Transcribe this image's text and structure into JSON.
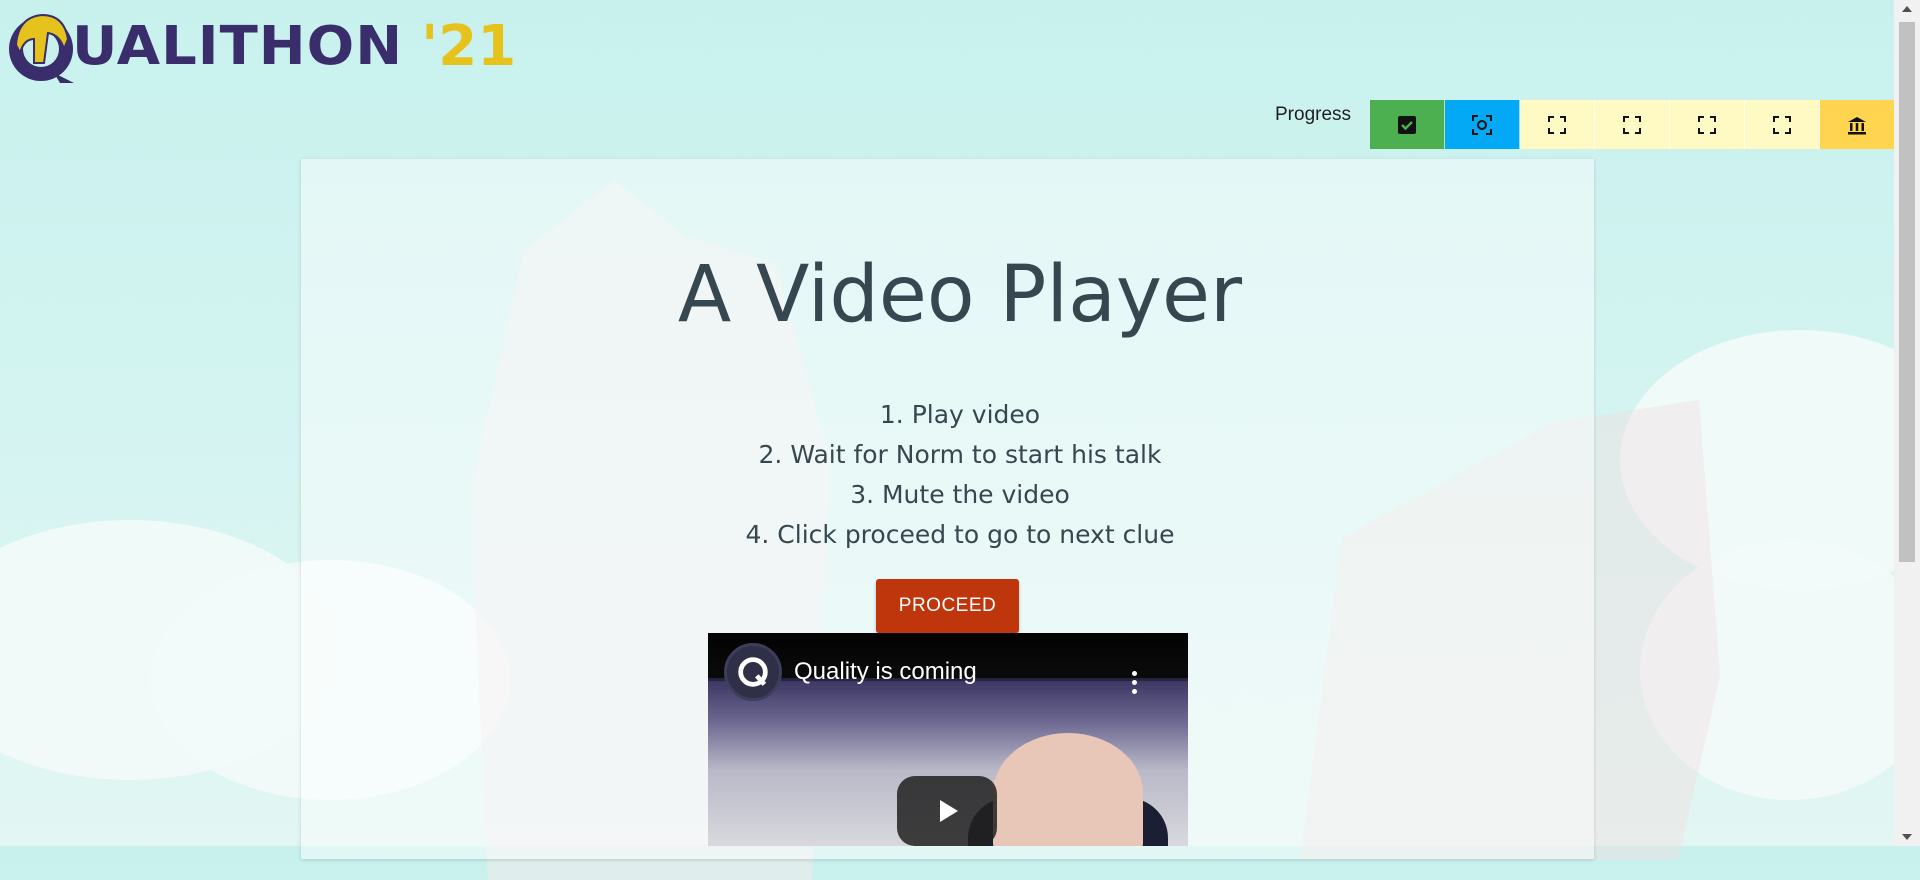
{
  "logo": {
    "main_text": "UALITHON",
    "year_text": "'21",
    "icon": "spartan-helmet-icon"
  },
  "progress": {
    "label": "Progress",
    "steps": [
      {
        "name": "completed",
        "icon": "check-box-icon",
        "color": "#4caf50"
      },
      {
        "name": "current",
        "icon": "focus-target-icon",
        "color": "#03a9f4"
      },
      {
        "name": "locked-1",
        "icon": "fullscreen-corners-icon",
        "color": "#fff9c4"
      },
      {
        "name": "locked-2",
        "icon": "fullscreen-corners-icon",
        "color": "#fff9c4"
      },
      {
        "name": "locked-3",
        "icon": "fullscreen-corners-icon",
        "color": "#fff9c4"
      },
      {
        "name": "locked-4",
        "icon": "fullscreen-corners-icon",
        "color": "#fff9c4"
      },
      {
        "name": "bank",
        "icon": "bank-icon",
        "color": "#ffd54f"
      }
    ]
  },
  "main": {
    "title": "A Video Player",
    "steps": [
      "1. Play video",
      "2. Wait for Norm to start his talk",
      "3. Mute the video",
      "4. Click proceed to go to next clue"
    ],
    "proceed_label": "PROCEED"
  },
  "video": {
    "title": "Quality is coming",
    "channel_icon": "q-logo-icon",
    "play_icon": "play-icon"
  },
  "colors": {
    "accent": "#bf360c",
    "title_text": "#37474f",
    "logo_purple": "#3a2d6b",
    "logo_yellow": "#e6c21c"
  }
}
